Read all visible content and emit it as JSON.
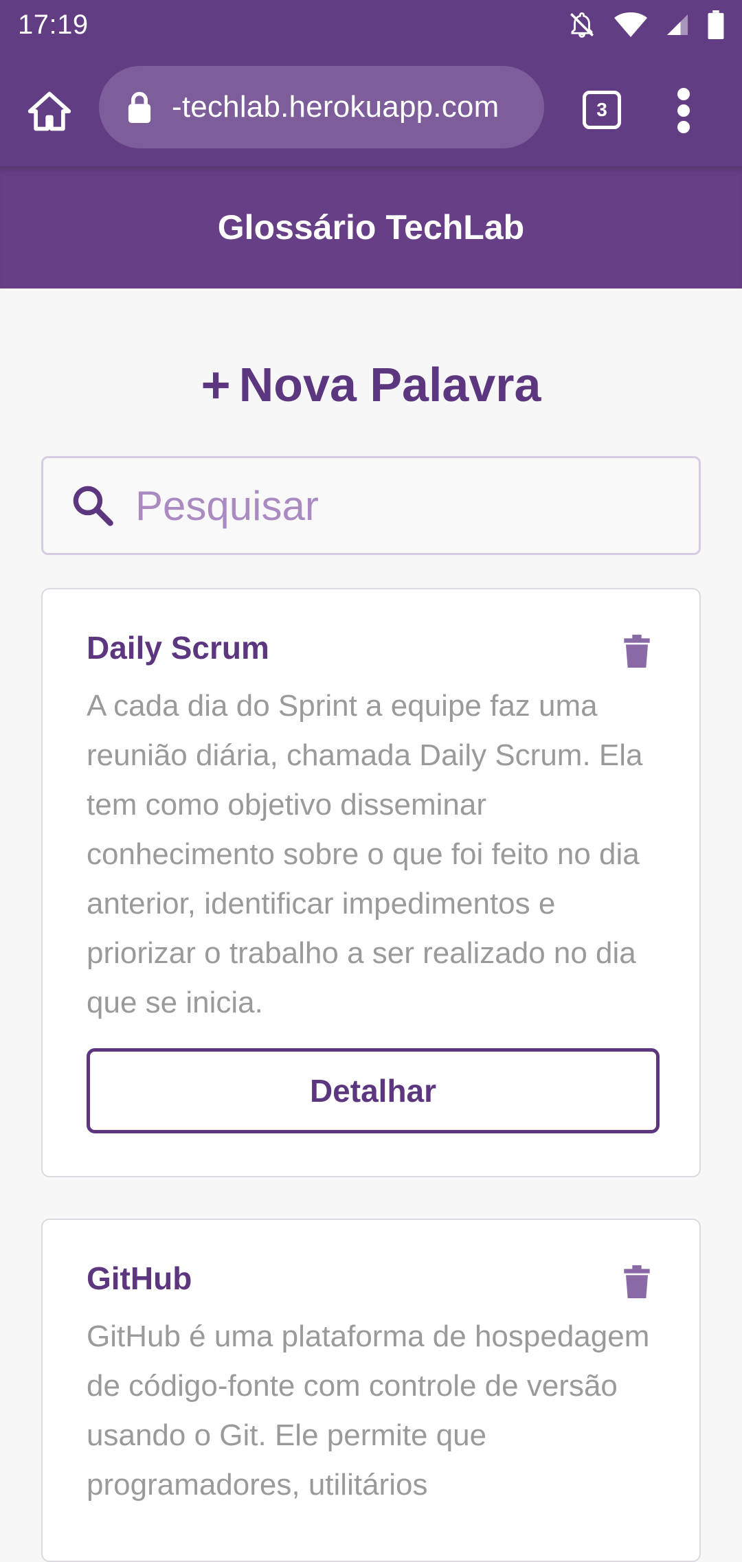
{
  "status_bar": {
    "time": "17:19",
    "icons": [
      "notifications-off-icon",
      "wifi-icon",
      "signal-icon",
      "battery-icon"
    ]
  },
  "browser": {
    "url": "-techlab.herokuapp.com",
    "tab_count": "3",
    "icons": [
      "home-icon",
      "lock-icon",
      "more-vert-icon"
    ]
  },
  "header": {
    "title": "Glossário TechLab"
  },
  "new_word": {
    "plus": "+",
    "label": "Nova Palavra"
  },
  "search": {
    "placeholder": "Pesquisar"
  },
  "cards": [
    {
      "title": "Daily Scrum",
      "description": "A cada dia do Sprint a equipe faz uma reunião diária, chamada Daily Scrum. Ela tem como objetivo disseminar conhecimento sobre o que foi feito no dia anterior, identificar impedimentos e priorizar o trabalho a ser realizado no dia que se inicia.",
      "button_label": "Detalhar"
    },
    {
      "title": "GitHub",
      "description": "GitHub é uma plataforma de hospedagem de código-fonte com controle de versão usando o Git. Ele permite que programadores, utilitários"
    }
  ],
  "colors": {
    "brand": "#633d84",
    "accent": "#5c3780",
    "placeholder": "#a98bc2",
    "body_text": "#9a9a9a"
  }
}
